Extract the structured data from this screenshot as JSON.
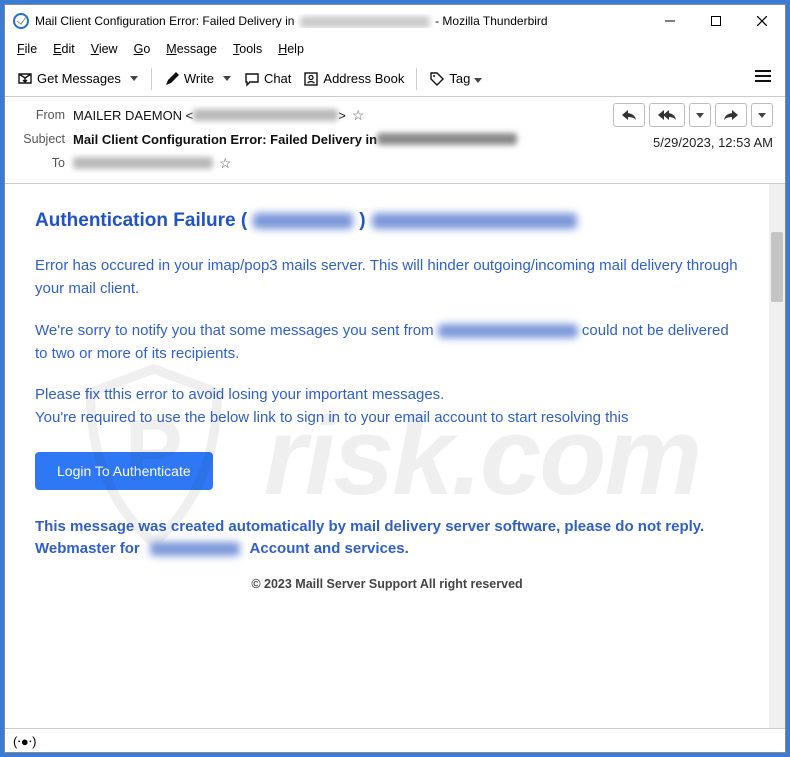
{
  "window": {
    "title_prefix": "Mail Client Configuration Error: Failed Delivery in ",
    "title_suffix": " - Mozilla Thunderbird"
  },
  "menubar": [
    "File",
    "Edit",
    "View",
    "Go",
    "Message",
    "Tools",
    "Help"
  ],
  "toolbar": {
    "get_messages": "Get Messages",
    "write": "Write",
    "chat": "Chat",
    "address_book": "Address Book",
    "tag": "Tag"
  },
  "headers": {
    "from_label": "From",
    "from_value": "MAILER DAEMON <",
    "from_close": ">",
    "subject_label": "Subject",
    "subject_value": "Mail Client Configuration Error: Failed Delivery in ",
    "to_label": "To",
    "date": "5/29/2023, 12:53 AM"
  },
  "body": {
    "heading": "Authentication Failure (",
    "heading_close": ")",
    "p1": "Error has occured in your imap/pop3 mails server. This will hinder outgoing/incoming mail delivery through your mail client.",
    "p2a": "We're sorry to notify you that some messages you sent from ",
    "p2b": " could not be delivered to two or more of its recipients.",
    "p3": "Please fix tthis error to avoid losing your important messages.",
    "p4": "You're required to use the below link to sign in to your email account to start resolving this",
    "button": "Login To Authenticate",
    "footer1": "This message was created automatically by mail delivery server software, please do not reply.",
    "footer2a": "Webmaster for ",
    "footer2b": " Account and services.",
    "copyright": "© 2023 Maill Server Support All right reserved"
  }
}
